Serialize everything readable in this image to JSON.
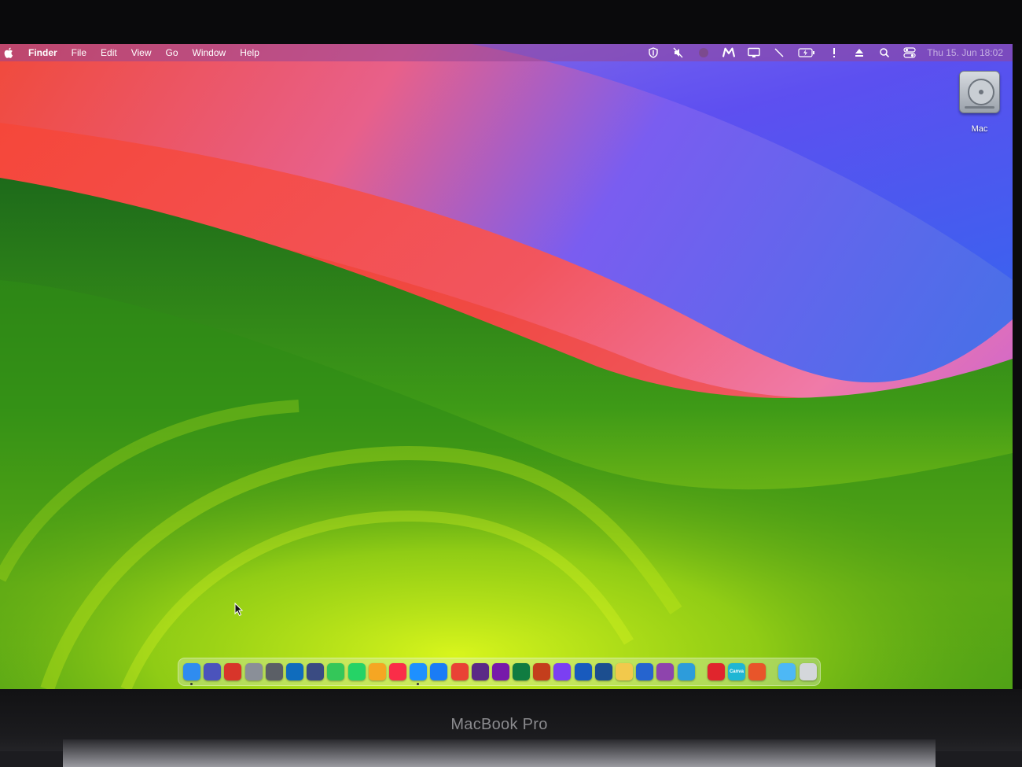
{
  "menubar": {
    "apple_icon": "apple-icon",
    "app_name": "Finder",
    "menus": [
      "File",
      "Edit",
      "View",
      "Go",
      "Window",
      "Help"
    ],
    "status_icons": [
      "shield-icon",
      "mute-icon",
      "dark-circle-icon",
      "m-logo-icon",
      "display-icon",
      "pen-icon",
      "battery-charging-icon",
      "alert-icon",
      "eject-icon",
      "search-icon",
      "control-center-icon"
    ],
    "clock": "Thu 15. Jun  18:02"
  },
  "desktop": {
    "icons": [
      {
        "label": "Mac",
        "icon": "hard-drive-icon"
      }
    ]
  },
  "dock": {
    "apps": [
      {
        "name": "finder-icon",
        "color": "#2f8cf0",
        "running": true
      },
      {
        "name": "teams-icon",
        "color": "#4b53bc"
      },
      {
        "name": "photo-booth-icon",
        "color": "#d8352a"
      },
      {
        "name": "launchpad-icon",
        "color": "#8a8f98"
      },
      {
        "name": "system-settings-icon",
        "color": "#5b5f66"
      },
      {
        "name": "outlook-icon",
        "color": "#0f6cbd"
      },
      {
        "name": "books-icon",
        "color": "#3a4b82"
      },
      {
        "name": "messages-icon",
        "color": "#34c759"
      },
      {
        "name": "whatsapp-icon",
        "color": "#25d366"
      },
      {
        "name": "widget-icon",
        "color": "#f5a623"
      },
      {
        "name": "music-icon",
        "color": "#fa2d48"
      },
      {
        "name": "safari-icon",
        "color": "#1e90ff",
        "running": true
      },
      {
        "name": "app-store-icon",
        "color": "#1a7cf5"
      },
      {
        "name": "chrome-icon",
        "color": "#e94235"
      },
      {
        "name": "tor-icon",
        "color": "#5b2a86"
      },
      {
        "name": "onenote-icon",
        "color": "#7719aa"
      },
      {
        "name": "excel-icon",
        "color": "#107c41"
      },
      {
        "name": "powerpoint-icon",
        "color": "#c43e1c"
      },
      {
        "name": "messenger-icon",
        "color": "#7b3ff2"
      },
      {
        "name": "word-icon",
        "color": "#185abd"
      },
      {
        "name": "remote-desktop-icon",
        "color": "#1c4e8f"
      },
      {
        "name": "photos-icon",
        "color": "#f2c94c"
      },
      {
        "name": "todo-icon",
        "color": "#2564cf"
      },
      {
        "name": "speech-icon",
        "color": "#8e44ad"
      },
      {
        "name": "network-icon",
        "color": "#2d9cdb"
      }
    ],
    "extras": [
      {
        "name": "opera-icon",
        "color": "#e0252d"
      },
      {
        "name": "canva-icon",
        "color": "#1fb6d4",
        "label": "Canva"
      },
      {
        "name": "office-icon",
        "color": "#e8552a"
      }
    ],
    "right": [
      {
        "name": "folder-icon",
        "color": "#4db8f5"
      },
      {
        "name": "trash-icon",
        "color": "#d4d7db"
      }
    ]
  },
  "device": {
    "model": "MacBook Pro"
  }
}
